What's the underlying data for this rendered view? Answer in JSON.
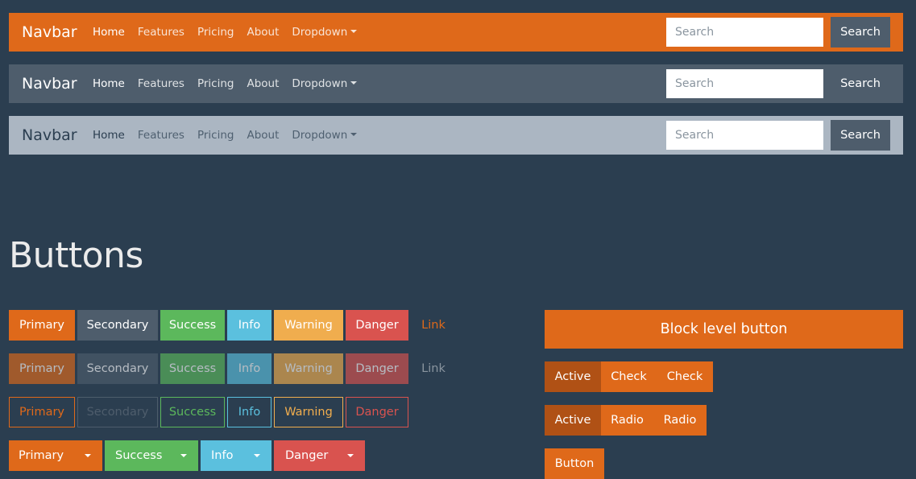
{
  "navbars": [
    {
      "variant": "primary",
      "brand": "Navbar",
      "links": [
        "Home",
        "Features",
        "Pricing",
        "About",
        "Dropdown"
      ],
      "search_placeholder": "Search",
      "search_button": "Search"
    },
    {
      "variant": "secondary",
      "brand": "Navbar",
      "links": [
        "Home",
        "Features",
        "Pricing",
        "About",
        "Dropdown"
      ],
      "search_placeholder": "Search",
      "search_button": "Search"
    },
    {
      "variant": "light",
      "brand": "Navbar",
      "links": [
        "Home",
        "Features",
        "Pricing",
        "About",
        "Dropdown"
      ],
      "search_placeholder": "Search",
      "search_button": "Search"
    }
  ],
  "buttons_heading": "Buttons",
  "button_rows": {
    "normal": [
      "Primary",
      "Secondary",
      "Success",
      "Info",
      "Warning",
      "Danger",
      "Link"
    ],
    "disabled": [
      "Primary",
      "Secondary",
      "Success",
      "Info",
      "Warning",
      "Danger",
      "Link"
    ],
    "outline": [
      "Primary",
      "Secondary",
      "Success",
      "Info",
      "Warning",
      "Danger"
    ],
    "split": [
      "Primary",
      "Success",
      "Info",
      "Danger"
    ]
  },
  "block_button": "Block level button",
  "check_group": [
    "Active",
    "Check",
    "Check"
  ],
  "radio_group": [
    "Active",
    "Radio",
    "Radio"
  ],
  "bottom_button": "Button",
  "colors": {
    "background": "#2b3e50",
    "primary": "#df691a",
    "secondary": "#4e5d6c",
    "success": "#5cb85c",
    "info": "#5bc0de",
    "warning": "#f0ad4e",
    "danger": "#d9534f",
    "light": "#abb6c2"
  }
}
